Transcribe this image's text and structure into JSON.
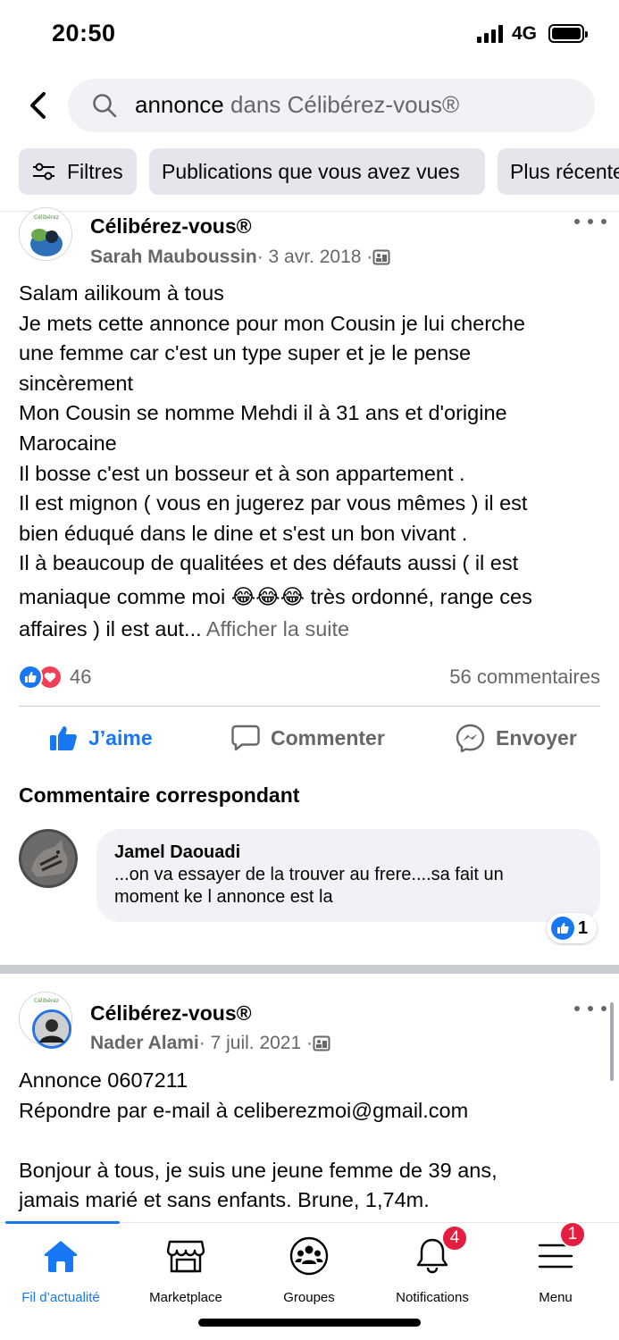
{
  "status_bar": {
    "time": "20:50",
    "network": "4G"
  },
  "search": {
    "query": "annonce",
    "scope": " dans Célibérez-vous®"
  },
  "filters": {
    "filters_label": "Filtres",
    "seen_label": "Publications que vous avez vues",
    "recent_label": "Plus récente"
  },
  "post1": {
    "group": "Célibérez-vous®",
    "author": "Sarah Mauboussin",
    "date": " · 3 avr. 2018 · ",
    "lines": [
      "Salam ailikoum à tous",
      "Je mets cette annonce pour mon Cousin je lui cherche",
      "une femme car c'est un type super et je le pense",
      "sincèrement",
      "Mon Cousin se nomme Mehdi il à 31 ans et d'origine",
      "Marocaine",
      "Il bosse c'est un bosseur et à son appartement .",
      "Il est mignon ( vous en jugerez par vous mêmes ) il est",
      "bien éduqué dans le dine et s'est un bon vivant .",
      "Il à beaucoup de qualitées et des défauts aussi ( il est",
      "maniaque comme moi 😂😂😂 très ordonné, range ces",
      "affaires ) il est aut... "
    ],
    "see_more": "Afficher la suite",
    "reaction_count": "46",
    "comments_count": "56 commentaires",
    "like_label": "J’aime",
    "comment_label": "Commenter",
    "send_label": "Envoyer",
    "matching_title": "Commentaire correspondant",
    "comment": {
      "author": "Jamel Daouadi",
      "lines": [
        "...on va essayer de la trouver au frere....sa fait un",
        "moment ke l annonce est la"
      ],
      "reaction_count": "1"
    }
  },
  "post2": {
    "group": "Célibérez-vous®",
    "author": "Nader Alami",
    "date": " · 7 juil. 2021 · ",
    "lines": [
      "Annonce 0607211",
      "Répondre par e-mail à celiberezmoi@gmail.com",
      "",
      "Bonjour à tous, je suis une jeune femme de 39 ans,",
      "jamais marié et sans enfants. Brune, 1,74m."
    ]
  },
  "nav": {
    "feed": "Fil d’actualité",
    "marketplace": "Marketplace",
    "groups": "Groupes",
    "notifications": "Notifications",
    "notifications_badge": "4",
    "menu": "Menu",
    "menu_badge": "1"
  },
  "colors": {
    "accent": "#1877f2",
    "badge": "#e41e3f",
    "love": "#f33e58"
  }
}
